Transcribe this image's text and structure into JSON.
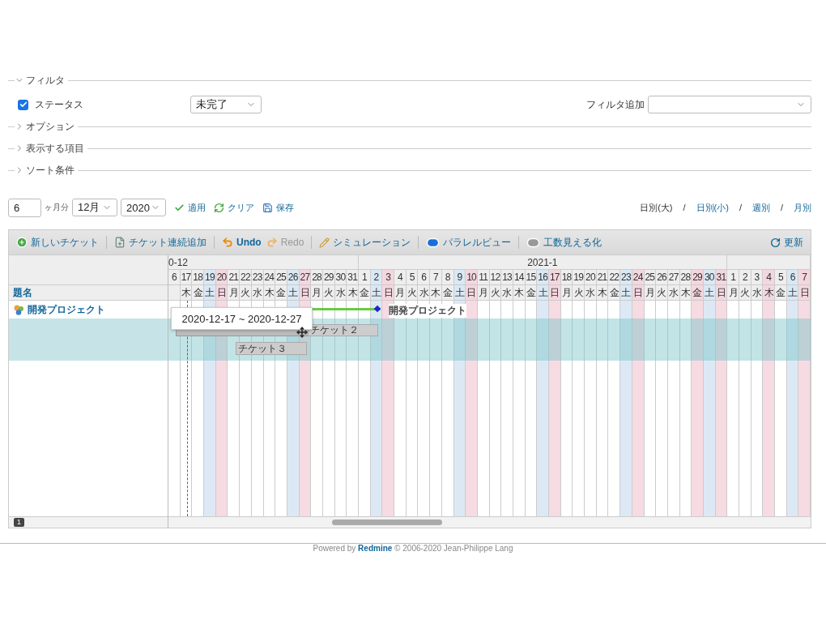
{
  "filters": {
    "sections": [
      {
        "label": "フィルタ",
        "expanded": true
      },
      {
        "label": "オプション",
        "expanded": false
      },
      {
        "label": "表示する項目",
        "expanded": false
      },
      {
        "label": "ソート条件",
        "expanded": false
      }
    ],
    "status": {
      "label": "ステータス",
      "checked": true,
      "value": "未完了"
    },
    "add_filter": {
      "label": "フィルタ追加"
    }
  },
  "period": {
    "months": "6",
    "months_label": "ヶ月分",
    "month": "12月",
    "year": "2020"
  },
  "actions": [
    {
      "label": "適用",
      "kind": "apply"
    },
    {
      "label": "クリア",
      "kind": "clear"
    },
    {
      "label": "保存",
      "kind": "save"
    }
  ],
  "zoom_links": [
    {
      "label": "日別(大)",
      "selected": true
    },
    {
      "label": "日別(小)",
      "selected": false
    },
    {
      "label": "週別",
      "selected": false
    },
    {
      "label": "月別",
      "selected": false
    }
  ],
  "separator": "/",
  "toolbar": [
    {
      "label": "新しいチケット",
      "kind": "new",
      "disabled": false
    },
    {
      "label": "チケット連続追加",
      "kind": "bulk",
      "disabled": false
    },
    {
      "label": "Undo",
      "kind": "undo",
      "disabled": false
    },
    {
      "label": "Redo",
      "kind": "redo",
      "disabled": true
    },
    {
      "label": "シミュレーション",
      "kind": "simulate",
      "disabled": false
    },
    {
      "label": "パラレルビュー",
      "kind": "toggle",
      "on": true
    },
    {
      "label": "工数見える化",
      "kind": "toggle",
      "on": false
    }
  ],
  "refresh": "更新",
  "gantt": {
    "subject_header": "題名",
    "months": [
      {
        "label": "0-12",
        "days": [
          {
            "day": "6",
            "kind": "weekday"
          },
          {
            "day": "17",
            "weekday": "木",
            "kind": "weekday"
          },
          {
            "day": "18",
            "weekday": "金",
            "kind": "weekday"
          },
          {
            "day": "19",
            "weekday": "土",
            "kind": "saturday"
          },
          {
            "day": "20",
            "weekday": "日",
            "kind": "holiday"
          },
          {
            "day": "21",
            "weekday": "月",
            "kind": "weekday"
          },
          {
            "day": "22",
            "weekday": "火",
            "kind": "weekday"
          },
          {
            "day": "23",
            "weekday": "水",
            "kind": "weekday"
          },
          {
            "day": "24",
            "weekday": "木",
            "kind": "weekday"
          },
          {
            "day": "25",
            "weekday": "金",
            "kind": "weekday"
          },
          {
            "day": "26",
            "weekday": "土",
            "kind": "saturday"
          },
          {
            "day": "27",
            "weekday": "日",
            "kind": "holiday"
          },
          {
            "day": "28",
            "weekday": "月",
            "kind": "weekday"
          },
          {
            "day": "29",
            "weekday": "火",
            "kind": "weekday"
          },
          {
            "day": "30",
            "weekday": "水",
            "kind": "weekday"
          },
          {
            "day": "31",
            "weekday": "木",
            "kind": "weekday"
          }
        ]
      },
      {
        "label": "2021-1",
        "days": [
          {
            "day": "1",
            "weekday": "金",
            "kind": "weekday"
          },
          {
            "day": "2",
            "weekday": "土",
            "kind": "saturday"
          },
          {
            "day": "3",
            "weekday": "日",
            "kind": "holiday"
          },
          {
            "day": "4",
            "weekday": "月",
            "kind": "weekday"
          },
          {
            "day": "5",
            "weekday": "火",
            "kind": "weekday"
          },
          {
            "day": "6",
            "weekday": "水",
            "kind": "weekday"
          },
          {
            "day": "7",
            "weekday": "木",
            "kind": "weekday"
          },
          {
            "day": "8",
            "weekday": "金",
            "kind": "weekday"
          },
          {
            "day": "9",
            "weekday": "土",
            "kind": "saturday"
          },
          {
            "day": "10",
            "weekday": "日",
            "kind": "holiday"
          },
          {
            "day": "11",
            "weekday": "月",
            "kind": "weekday"
          },
          {
            "day": "12",
            "weekday": "火",
            "kind": "weekday"
          },
          {
            "day": "13",
            "weekday": "水",
            "kind": "weekday"
          },
          {
            "day": "14",
            "weekday": "木",
            "kind": "weekday"
          },
          {
            "day": "15",
            "weekday": "金",
            "kind": "weekday"
          },
          {
            "day": "16",
            "weekday": "土",
            "kind": "saturday"
          },
          {
            "day": "17",
            "weekday": "日",
            "kind": "holiday"
          },
          {
            "day": "18",
            "weekday": "月",
            "kind": "weekday"
          },
          {
            "day": "19",
            "weekday": "火",
            "kind": "weekday"
          },
          {
            "day": "20",
            "weekday": "水",
            "kind": "weekday"
          },
          {
            "day": "21",
            "weekday": "木",
            "kind": "weekday"
          },
          {
            "day": "22",
            "weekday": "金",
            "kind": "weekday"
          },
          {
            "day": "23",
            "weekday": "土",
            "kind": "saturday"
          },
          {
            "day": "24",
            "weekday": "日",
            "kind": "holiday"
          },
          {
            "day": "25",
            "weekday": "月",
            "kind": "weekday"
          },
          {
            "day": "26",
            "weekday": "火",
            "kind": "weekday"
          },
          {
            "day": "27",
            "weekday": "水",
            "kind": "weekday"
          },
          {
            "day": "28",
            "weekday": "木",
            "kind": "weekday"
          },
          {
            "day": "29",
            "weekday": "金",
            "kind": "holiday"
          },
          {
            "day": "30",
            "weekday": "土",
            "kind": "saturday"
          },
          {
            "day": "31",
            "weekday": "日",
            "kind": "holiday"
          }
        ]
      },
      {
        "days": [
          {
            "day": "1",
            "weekday": "月",
            "kind": "weekday"
          },
          {
            "day": "2",
            "weekday": "火",
            "kind": "weekday"
          },
          {
            "day": "3",
            "weekday": "水",
            "kind": "weekday"
          },
          {
            "day": "4",
            "weekday": "木",
            "kind": "holiday"
          },
          {
            "day": "5",
            "weekday": "金",
            "kind": "weekday"
          },
          {
            "day": "6",
            "weekday": "土",
            "kind": "saturday"
          },
          {
            "day": "7",
            "weekday": "日",
            "kind": "holiday"
          }
        ]
      }
    ],
    "rows": [
      {
        "kind": "project",
        "subject": "開発プロジェクト",
        "bar_label": "開発プロジェクト",
        "selected": false
      },
      {
        "kind": "issue",
        "bar_label": "チケット２",
        "selected": true
      },
      {
        "kind": "issue",
        "bar_label": "チケット３",
        "selected": true
      }
    ],
    "tooltip": "2020-12-17 ~ 2020-12-27",
    "page_badge": "1"
  },
  "footer": {
    "text": "Powered by ",
    "link": "Redmine",
    "rest": " © 2006-2020 Jean-Philippe Lang"
  }
}
